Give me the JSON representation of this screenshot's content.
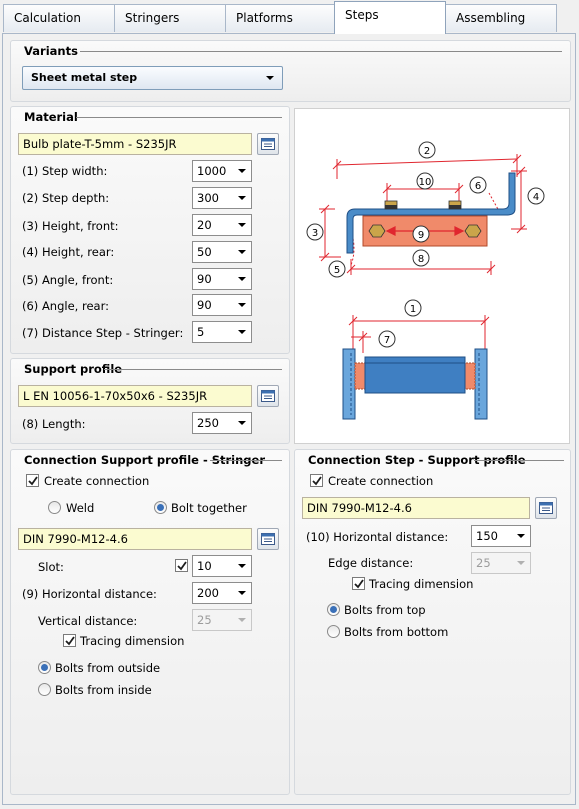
{
  "tabs": [
    "Calculation",
    "Stringers",
    "Platforms",
    "Steps",
    "Assembling"
  ],
  "active_tab": "Steps",
  "variants": {
    "title": "Variants",
    "selected": "Sheet metal step"
  },
  "material": {
    "title": "Material",
    "value": "Bulb plate-T-5mm - S235JR",
    "rows": [
      {
        "label": "(1) Step width:",
        "value": "1000"
      },
      {
        "label": "(2) Step depth:",
        "value": "300"
      },
      {
        "label": "(3) Height, front:",
        "value": "20"
      },
      {
        "label": "(4) Height, rear:",
        "value": "50"
      },
      {
        "label": "(5) Angle, front:",
        "value": "90"
      },
      {
        "label": "(6) Angle, rear:",
        "value": "90"
      },
      {
        "label": "(7) Distance Step - Stringer:",
        "value": "5"
      }
    ]
  },
  "support": {
    "title": "Support profile",
    "value": "L EN 10056-1-70x50x6 - S235JR",
    "length_label": "(8) Length:",
    "length_value": "250"
  },
  "conn_left": {
    "title": "Connection Support profile - Stringer",
    "create_label": "Create connection",
    "weld_label": "Weld",
    "bolt_label": "Bolt together",
    "bolt_value": "DIN 7990-M12-4.6",
    "slot_label": "Slot:",
    "slot_value": "10",
    "hdist_label": "(9) Horizontal distance:",
    "hdist_value": "200",
    "vdist_label": "Vertical distance:",
    "vdist_value": "25",
    "tracing_label": "Tracing dimension",
    "outside_label": "Bolts from outside",
    "inside_label": "Bolts from inside"
  },
  "conn_right": {
    "title": "Connection Step - Support profile",
    "create_label": "Create connection",
    "bolt_value": "DIN 7990-M12-4.6",
    "hdist_label": "(10) Horizontal distance:",
    "hdist_value": "150",
    "edge_label": "Edge distance:",
    "edge_value": "25",
    "tracing_label": "Tracing dimension",
    "top_label": "Bolts from top",
    "bottom_label": "Bolts from bottom"
  },
  "diagram_labels": [
    "2",
    "10",
    "6",
    "4",
    "3",
    "9",
    "5",
    "8",
    "1",
    "7"
  ],
  "colors": {
    "accent": "#3a70b8",
    "dimension": "#e0262f",
    "profile": "#4a8cc8",
    "plate": "#f08a6a",
    "field_bg": "#fbfbd0"
  }
}
